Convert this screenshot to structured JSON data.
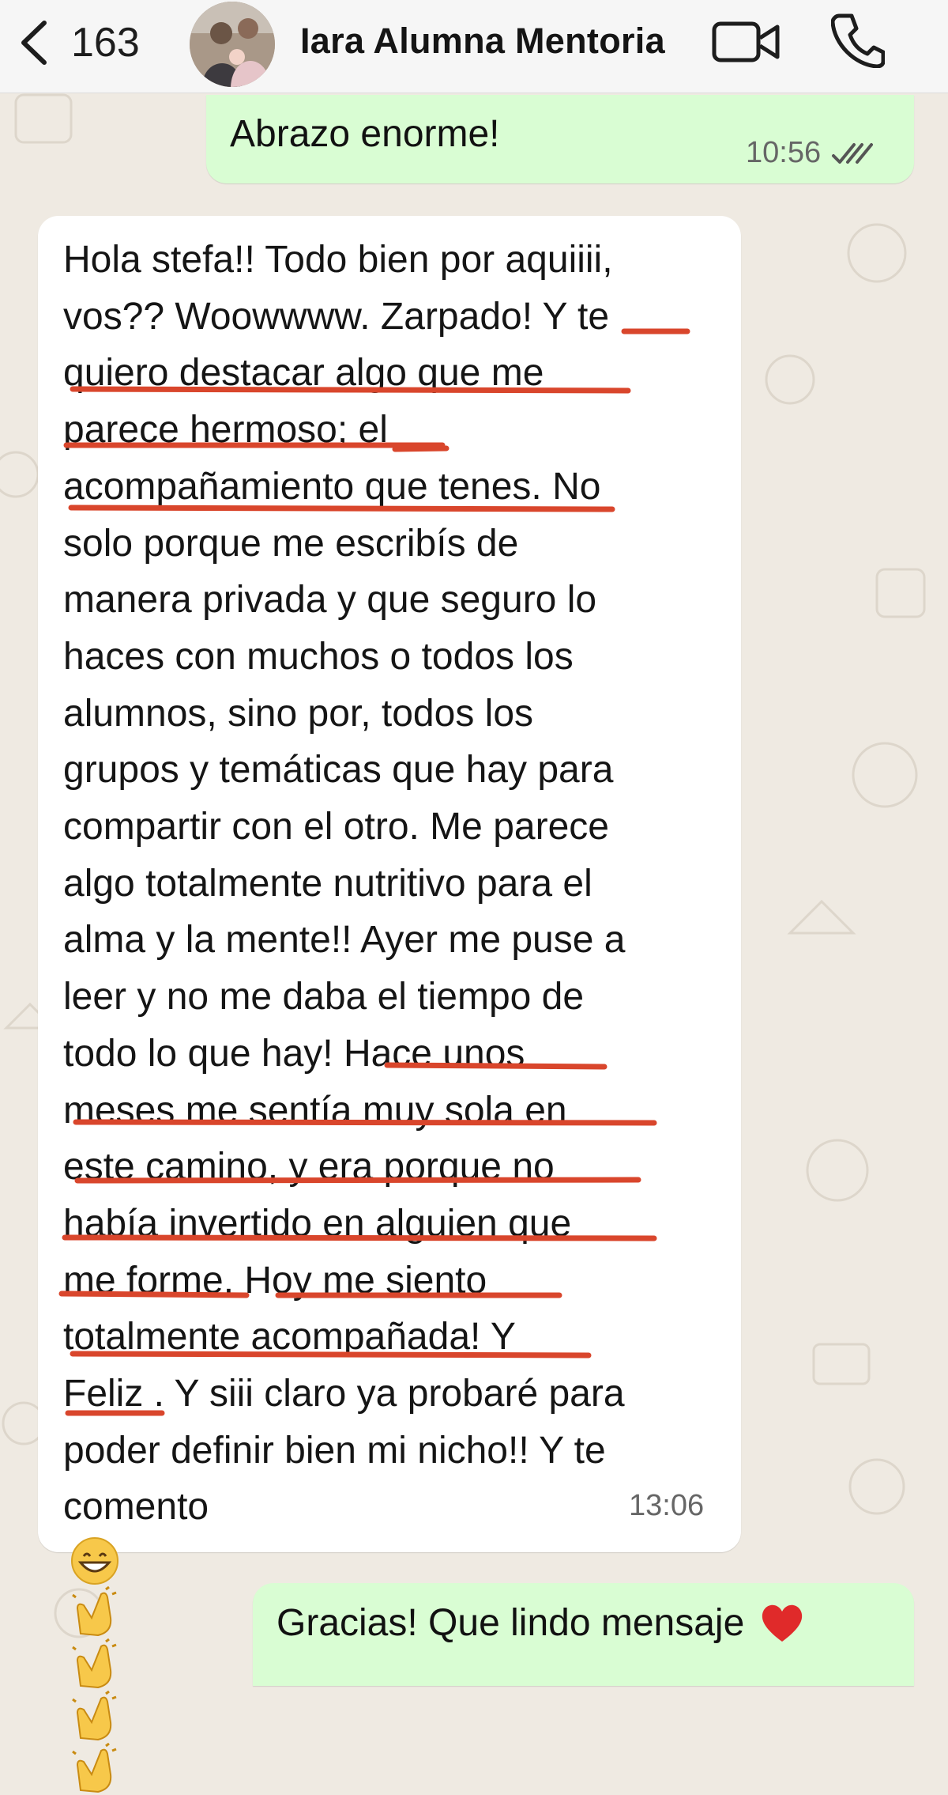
{
  "header": {
    "back_count": "163",
    "contact_name": "Iara Alumna Mentoria"
  },
  "messages": [
    {
      "direction": "outgoing",
      "text": "Abrazo enorme!",
      "time": "10:56",
      "status": "read"
    },
    {
      "direction": "incoming",
      "lines": [
        "Hola stefa!! Todo bien por aquiiii,",
        "vos?? Woowwww. Zarpado! Y te",
        "quiero destacar algo que me",
        "parece hermoso; el",
        "acompañamiento que tenes. No",
        "solo porque me escribís de",
        "manera privada y que seguro lo",
        "haces con muchos o todos los",
        "alumnos, sino por, todos los",
        "grupos y temáticas que hay para",
        "compartir con el otro. Me parece",
        "algo totalmente nutritivo para el",
        "alma y la mente!! Ayer me puse a",
        "leer y no me daba el tiempo de",
        "todo lo que hay! Hace unos",
        "meses me sentía muy sola en",
        "este camino, y era porque no",
        "había invertido en alguien que",
        "me forme. Hoy me siento",
        "totalmente acompañada! Y",
        "Feliz . Y siii claro ya probaré para",
        "poder definir bien mi nicho!! Y te",
        "comento"
      ],
      "emojis": [
        "grinning-face",
        "clapping-hands",
        "clapping-hands",
        "clapping-hands",
        "clapping-hands"
      ],
      "time": "13:06"
    },
    {
      "direction": "outgoing",
      "text": "Gracias! Que lindo mensaje",
      "emoji": "red-heart"
    }
  ],
  "colors": {
    "outgoing_bubble": "#d9fdd3",
    "incoming_bubble": "#ffffff",
    "chat_background": "#efeae2",
    "underline": "#d9462c",
    "read_ticks": "#555555"
  }
}
